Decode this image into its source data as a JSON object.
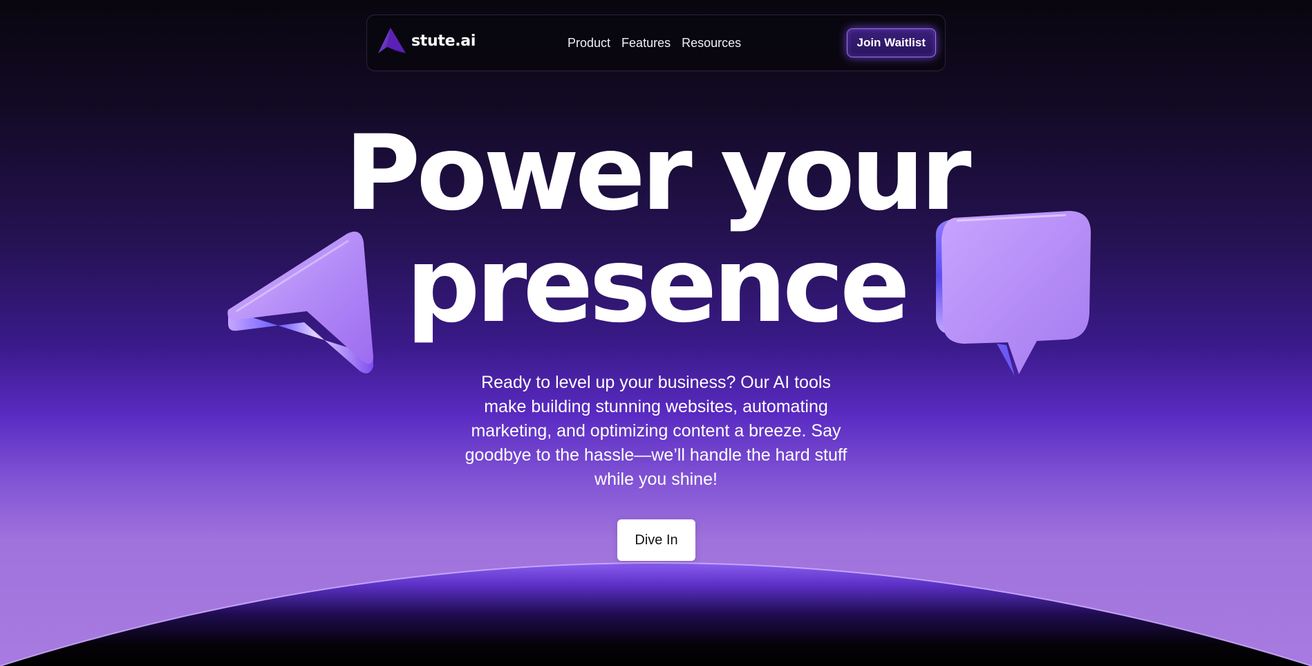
{
  "brand": {
    "name": "stute.ai",
    "accent": "#7c3aed"
  },
  "nav": {
    "links": [
      {
        "label": "Product"
      },
      {
        "label": "Features"
      },
      {
        "label": "Resources"
      }
    ],
    "cta_label": "Join Waitlist"
  },
  "hero": {
    "title_line1": "Power your",
    "title_line2": "presence",
    "subtitle": "Ready to level up your business? Our AI tools make building stunning websites, automating marketing, and optimizing content a breeze. Say goodbye to the hassle—we’ll handle the hard stuff while you shine!",
    "cta_label": "Dive In"
  },
  "decorations": {
    "left": "cursor-arrow-icon",
    "right": "chat-bubble-icon"
  },
  "colors": {
    "background_top": "#09060f",
    "background_mid": "#3a1a8a",
    "background_bottom": "#a77be0",
    "button_glow": "#9b72f5"
  }
}
